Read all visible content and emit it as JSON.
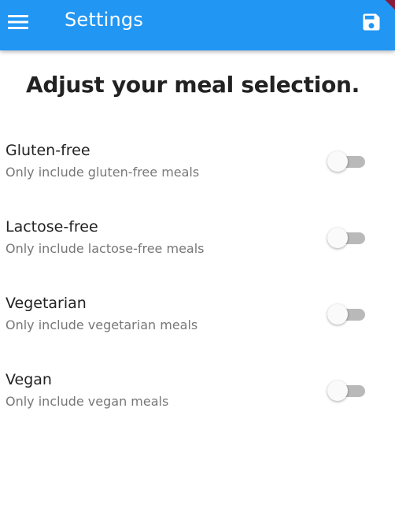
{
  "appbar": {
    "title": "Settings",
    "menu_icon": "menu-icon",
    "save_icon": "save-icon",
    "background": "#2196f3"
  },
  "heading": "Adjust your meal selection.",
  "filters": [
    {
      "title": "Gluten-free",
      "subtitle": "Only include gluten-free meals",
      "enabled": false
    },
    {
      "title": "Lactose-free",
      "subtitle": "Only include lactose-free meals",
      "enabled": false
    },
    {
      "title": "Vegetarian",
      "subtitle": "Only include vegetarian meals",
      "enabled": false
    },
    {
      "title": "Vegan",
      "subtitle": "Only include vegan meals",
      "enabled": false
    }
  ]
}
